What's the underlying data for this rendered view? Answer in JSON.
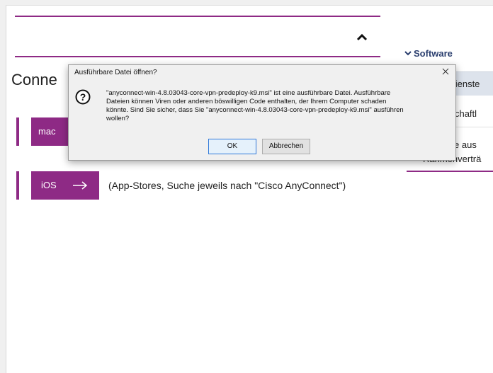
{
  "page": {
    "heading": "Conne",
    "mac_button_label": "mac",
    "ios_button_label": "iOS",
    "ios_description": "(App-Stores, Suche jeweils nach \"Cisco AnyConnect\")"
  },
  "sidebar": {
    "section_title": "Software",
    "items": [
      {
        "label": "-Dienste"
      },
      {
        "label": "enschaftl"
      },
      {
        "label_line1": "vare aus",
        "label_line2": "Rahmenverträ"
      }
    ]
  },
  "dialog": {
    "title": "Ausführbare Datei öffnen?",
    "message_lines": [
      "\"anyconnect-win-4.8.03043-core-vpn-predeploy-k9.msi\" ist eine ausführbare Datei. Ausführbare",
      "Dateien können Viren oder anderen böswilligen Code enthalten, der Ihrem Computer schaden",
      "könnte. Sind Sie sicher, dass Sie \"anyconnect-win-4.8.03043-core-vpn-predeploy-k9.msi\" ausführen",
      "wollen?"
    ],
    "ok_label": "OK",
    "cancel_label": "Abbrechen"
  },
  "colors": {
    "accent_purple": "#8e2a85",
    "link_blue": "#2a3e6e",
    "dialog_bg": "#f0f0f0"
  },
  "icons": [
    "chevron-up-icon",
    "chevron-down-icon",
    "arrow-right-icon",
    "question-icon",
    "close-icon"
  ]
}
